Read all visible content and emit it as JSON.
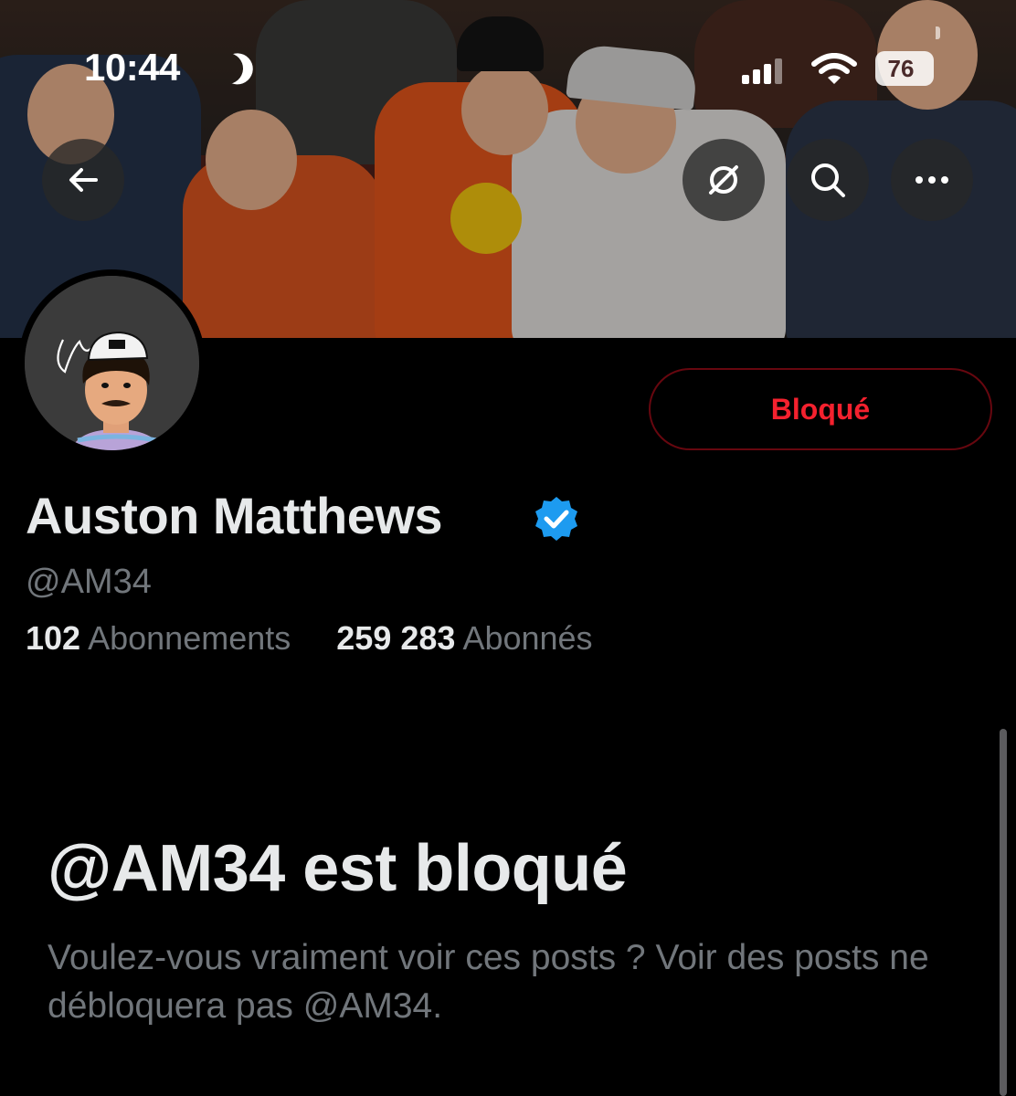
{
  "status_bar": {
    "time": "10:44",
    "battery": "76"
  },
  "header": {
    "back_icon": "arrow-left-icon",
    "grok_icon": "grok-slash-circle-icon",
    "search_icon": "search-icon",
    "more_icon": "more-horizontal-icon"
  },
  "avatar_signature": "AM34",
  "profile": {
    "display_name": "Auston Matthews",
    "handle": "@AM34",
    "verified": true,
    "following_count": "102",
    "following_label": "Abonnements",
    "followers_count": "259 283",
    "followers_label": "Abonnés"
  },
  "action": {
    "blocked_label": "Bloqué"
  },
  "blocked_notice": {
    "title": "@AM34 est bloqué",
    "description": "Voulez-vous vraiment voir ces posts ? Voir des posts ne débloquera pas @AM34."
  },
  "colors": {
    "background": "#000000",
    "text_primary": "#e7e9ea",
    "text_secondary": "#71767b",
    "danger": "#f4212e",
    "danger_border": "#67070f",
    "verified": "#1d9bf0"
  }
}
